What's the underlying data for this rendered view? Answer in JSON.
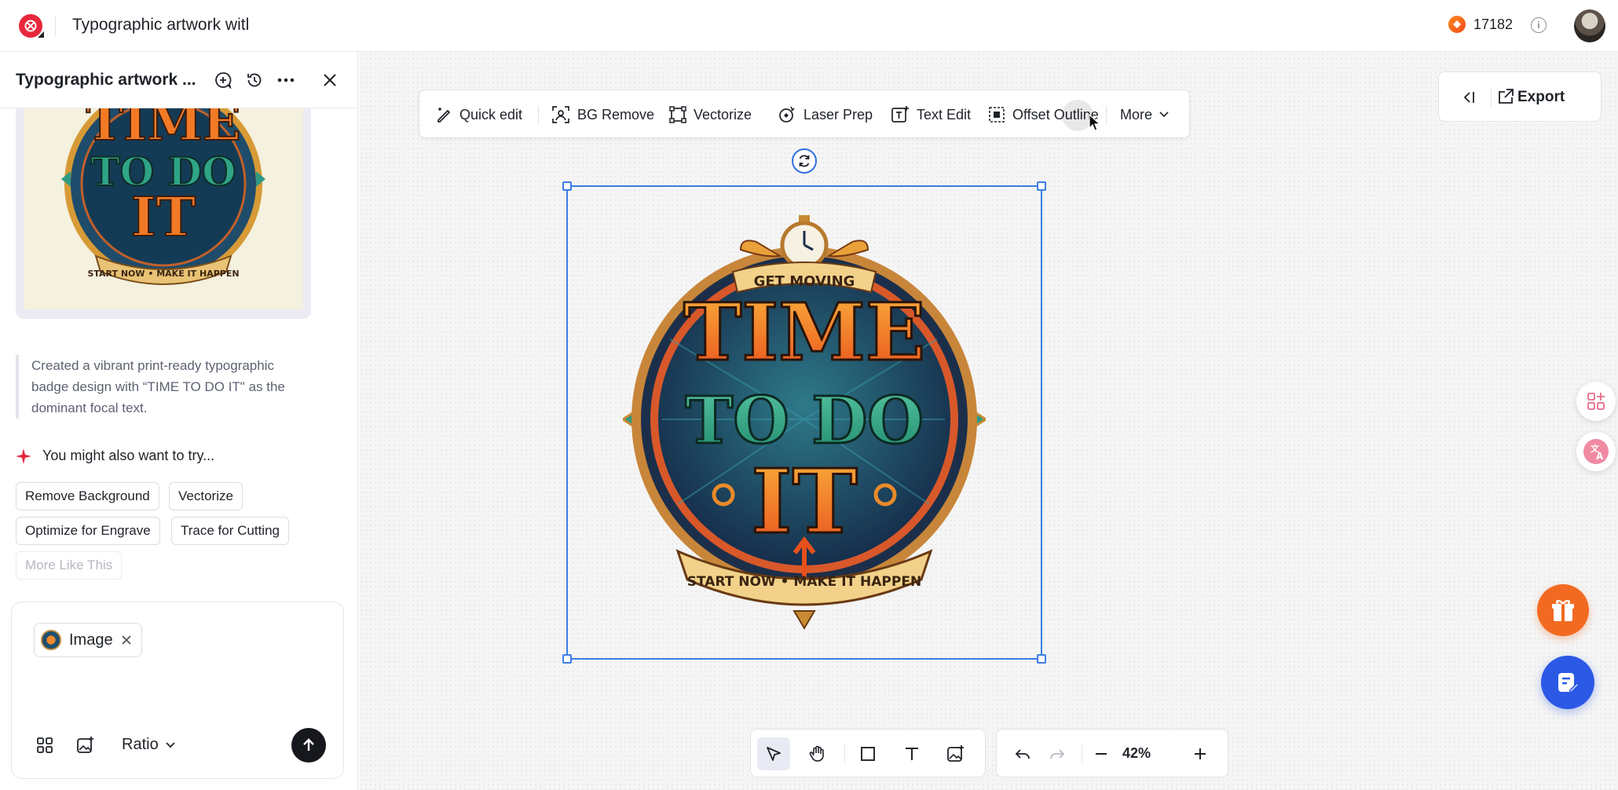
{
  "app": {
    "document_title": "Typographic artwork witl",
    "credits": "17182",
    "brand_color": "#e8283c"
  },
  "panel": {
    "title": "Typographic artwork ...",
    "header_icons": [
      "chat-plus-icon",
      "history-icon",
      "more-icon",
      "close-icon"
    ],
    "description": "Created a vibrant print-ready typographic badge design with “TIME TO DO IT\" as the dominant focal text.",
    "suggest_title": "You might also want to try...",
    "suggestions": [
      "Remove Background",
      "Vectorize",
      "Optimize for Engrave",
      "Trace for Cutting",
      "More Like This"
    ],
    "attachment_label": "Image",
    "ratio_label": "Ratio"
  },
  "toolbar": {
    "items": [
      {
        "label": "Quick edit",
        "icon": "quick-edit-icon"
      },
      {
        "label": "BG Remove",
        "icon": "bg-remove-icon"
      },
      {
        "label": "Vectorize",
        "icon": "vectorize-icon"
      },
      {
        "label": "Laser Prep",
        "icon": "laser-icon"
      },
      {
        "label": "Text Edit",
        "icon": "text-edit-icon"
      },
      {
        "label": "Offset Outline",
        "icon": "offset-outline-icon"
      }
    ],
    "more_label": "More"
  },
  "artwork": {
    "top_banner": "GET MOVING",
    "line1": "TIME",
    "line2": "TO DO",
    "line3": "IT",
    "bottom_ribbon": "START NOW • MAKE IT HAPPEN"
  },
  "thumbnail": {
    "line1": "TIME",
    "line2": "TO DO",
    "line3": "IT",
    "ribbon": "START NOW • MAKE IT HAPPEN"
  },
  "right_controls": {
    "export_label": "Export"
  },
  "zoom": {
    "level": "42%"
  },
  "colors": {
    "selection": "#3b7de6",
    "gift": "#f26a21",
    "chat": "#2b59e6"
  }
}
